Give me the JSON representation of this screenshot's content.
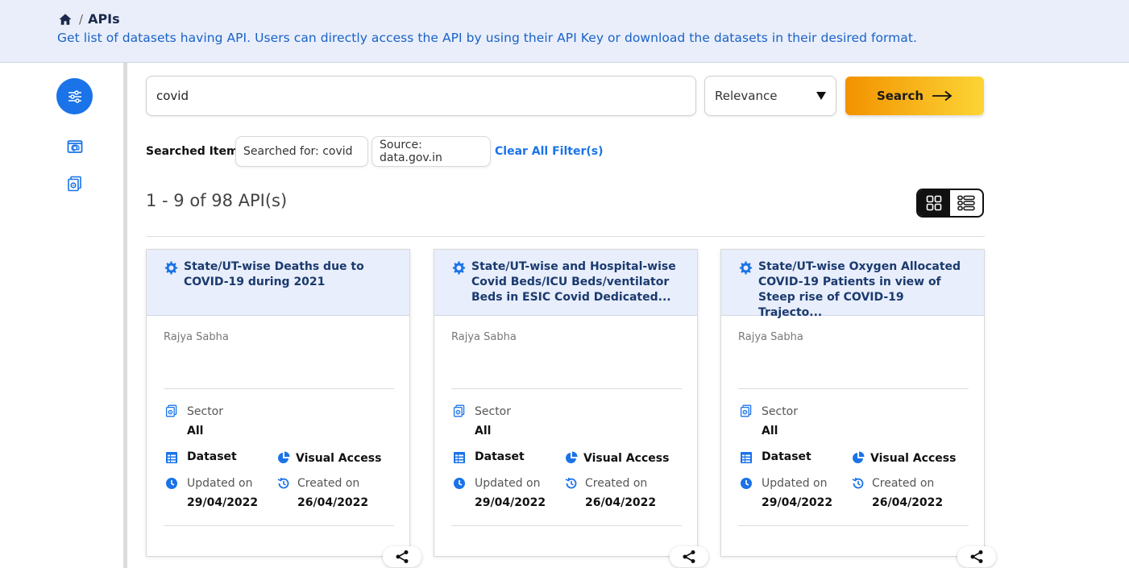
{
  "breadcrumb": {
    "separator": "/",
    "current": "APIs"
  },
  "header": {
    "description": "Get list of datasets having API. Users can directly access the API by using their API Key or download the datasets in their desired format."
  },
  "search": {
    "value": "covid",
    "sort_selected": "Relevance",
    "button_label": "Search"
  },
  "filters": {
    "label": "Searched Item:",
    "chips": [
      "Searched for: covid",
      "Source: data.gov.in"
    ],
    "clear_label": "Clear All Filter(s)"
  },
  "results": {
    "count_text": "1 - 9 of 98 API(s)",
    "view_mode": "grid"
  },
  "cards": [
    {
      "title": "State/UT-wise Deaths due to COVID-19 during 2021",
      "source": "Rajya Sabha",
      "sector_label": "Sector",
      "sector_value": "All",
      "dataset_label": "Dataset",
      "visual_label": "Visual Access",
      "updated_label": "Updated on",
      "updated_value": "29/04/2022",
      "created_label": "Created on",
      "created_value": "26/04/2022"
    },
    {
      "title": "State/UT-wise and Hospital-wise Covid Beds/ICU Beds/ventilator Beds in ESIC Covid Dedicated...",
      "source": "Rajya Sabha",
      "sector_label": "Sector",
      "sector_value": "All",
      "dataset_label": "Dataset",
      "visual_label": "Visual Access",
      "updated_label": "Updated on",
      "updated_value": "29/04/2022",
      "created_label": "Created on",
      "created_value": "26/04/2022"
    },
    {
      "title": "State/UT-wise Oxygen Allocated COVID-19 Patients in view of Steep rise of COVID-19 Trajecto...",
      "source": "Rajya Sabha",
      "sector_label": "Sector",
      "sector_value": "All",
      "dataset_label": "Dataset",
      "visual_label": "Visual Access",
      "updated_label": "Updated on",
      "updated_value": "29/04/2022",
      "created_label": "Created on",
      "created_value": "26/04/2022"
    }
  ],
  "icons": {
    "home": "home-icon",
    "filter": "sliders-icon",
    "sidebar_1": "at-sign-icon",
    "sidebar_2": "api-icon",
    "card_head": "gear-icon",
    "sector": "api-icon",
    "dataset": "table-icon",
    "visual": "pie-chart-icon",
    "updated": "clock-icon",
    "created": "history-icon",
    "share": "share-icon"
  },
  "colors": {
    "accent": "#1a73e8",
    "header_bg": "#e9eefa",
    "card_head_bg": "#e8eefb",
    "title": "#1b3a6e",
    "search_gradient_start": "#f39200",
    "search_gradient_end": "#fcd535"
  }
}
